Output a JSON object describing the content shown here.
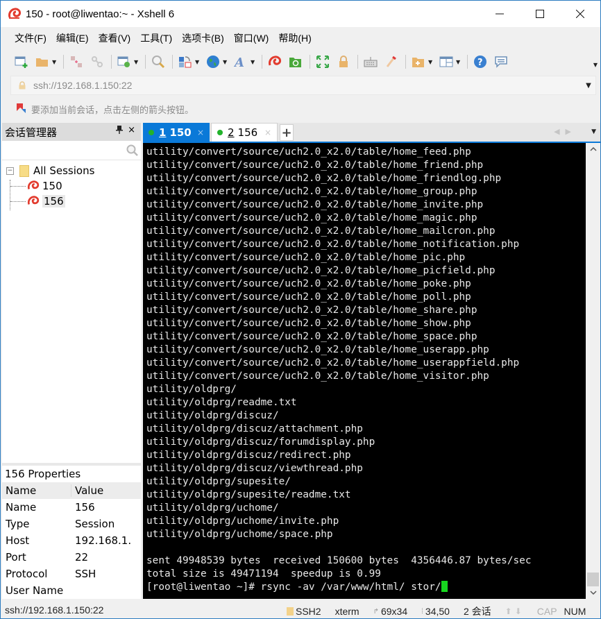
{
  "window": {
    "title": "150 - root@liwentao:~ - Xshell 6",
    "controls": {
      "minimize": "—",
      "maximize": "☐",
      "close": "✕"
    }
  },
  "menu": [
    "文件(F)",
    "编辑(E)",
    "查看(V)",
    "工具(T)",
    "选项卡(B)",
    "窗口(W)",
    "帮助(H)"
  ],
  "toolbar": {
    "buttons": [
      "new-session",
      "open",
      "disconnect",
      "reconnect",
      "properties",
      "find",
      "transfer",
      "web",
      "font",
      "xshell",
      "xftp",
      "fullscreen",
      "lock",
      "keyboard",
      "highlight",
      "new-folder",
      "layout",
      "help",
      "chat"
    ]
  },
  "address": {
    "value": "ssh://192.168.1.150:22"
  },
  "hint": {
    "text": "要添加当前会话，点击左侧的箭头按钮。"
  },
  "session_manager": {
    "title": "会话管理器",
    "pin": "ф",
    "close": "×",
    "search_placeholder": "",
    "tree": {
      "root": "All Sessions",
      "expander": "−",
      "children": [
        "150",
        "156"
      ],
      "selected": "156"
    },
    "properties": {
      "title": "156 Properties",
      "headers": [
        "Name",
        "Value"
      ],
      "rows": [
        [
          "Name",
          "156"
        ],
        [
          "Type",
          "Session"
        ],
        [
          "Host",
          "192.168.1."
        ],
        [
          "Port",
          "22"
        ],
        [
          "Protocol",
          "SSH"
        ],
        [
          "User Name",
          ""
        ]
      ]
    }
  },
  "tabs": {
    "items": [
      {
        "num": "1",
        "label": "150",
        "active": true
      },
      {
        "num": "2",
        "label": "156",
        "active": false
      }
    ],
    "add": "+",
    "close": "×"
  },
  "terminal": {
    "lines": [
      "utility/convert/source/uch2.0_x2.0/table/home_feed.php",
      "utility/convert/source/uch2.0_x2.0/table/home_friend.php",
      "utility/convert/source/uch2.0_x2.0/table/home_friendlog.php",
      "utility/convert/source/uch2.0_x2.0/table/home_group.php",
      "utility/convert/source/uch2.0_x2.0/table/home_invite.php",
      "utility/convert/source/uch2.0_x2.0/table/home_magic.php",
      "utility/convert/source/uch2.0_x2.0/table/home_mailcron.php",
      "utility/convert/source/uch2.0_x2.0/table/home_notification.php",
      "utility/convert/source/uch2.0_x2.0/table/home_pic.php",
      "utility/convert/source/uch2.0_x2.0/table/home_picfield.php",
      "utility/convert/source/uch2.0_x2.0/table/home_poke.php",
      "utility/convert/source/uch2.0_x2.0/table/home_poll.php",
      "utility/convert/source/uch2.0_x2.0/table/home_share.php",
      "utility/convert/source/uch2.0_x2.0/table/home_show.php",
      "utility/convert/source/uch2.0_x2.0/table/home_space.php",
      "utility/convert/source/uch2.0_x2.0/table/home_userapp.php",
      "utility/convert/source/uch2.0_x2.0/table/home_userappfield.php",
      "utility/convert/source/uch2.0_x2.0/table/home_visitor.php",
      "utility/oldprg/",
      "utility/oldprg/readme.txt",
      "utility/oldprg/discuz/",
      "utility/oldprg/discuz/attachment.php",
      "utility/oldprg/discuz/forumdisplay.php",
      "utility/oldprg/discuz/redirect.php",
      "utility/oldprg/discuz/viewthread.php",
      "utility/oldprg/supesite/",
      "utility/oldprg/supesite/readme.txt",
      "utility/oldprg/uchome/",
      "utility/oldprg/uchome/invite.php",
      "utility/oldprg/uchome/space.php",
      "",
      "sent 49948539 bytes  received 150600 bytes  4356446.87 bytes/sec",
      "total size is 49471194  speedup is 0.99"
    ],
    "prompt": "[root@liwentao ~]# rsync -av /var/www/html/ stor/"
  },
  "statusbar": {
    "address": "ssh://192.168.1.150:22",
    "protocol": "SSH2",
    "term": "xterm",
    "size": "69x34",
    "cursor_pos": "34,50",
    "sessions": "2 会话",
    "cap": "CAP",
    "num": "NUM"
  },
  "colors": {
    "accent": "#0a79d8",
    "terminal_bg": "#000000",
    "terminal_fg": "#e8e8e8",
    "cursor": "#17d61f",
    "connected_dot": "#22b22b"
  }
}
